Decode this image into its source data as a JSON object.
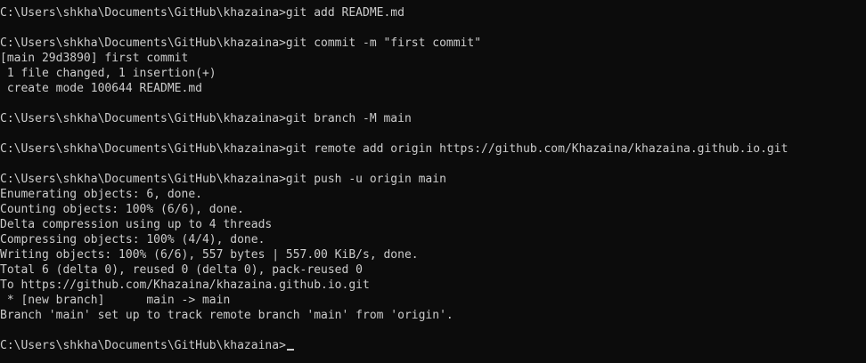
{
  "terminal": {
    "lines": [
      "C:\\Users\\shkha\\Documents\\GitHub\\khazaina>git add README.md",
      "",
      "C:\\Users\\shkha\\Documents\\GitHub\\khazaina>git commit -m \"first commit\"",
      "[main 29d3890] first commit",
      " 1 file changed, 1 insertion(+)",
      " create mode 100644 README.md",
      "",
      "C:\\Users\\shkha\\Documents\\GitHub\\khazaina>git branch -M main",
      "",
      "C:\\Users\\shkha\\Documents\\GitHub\\khazaina>git remote add origin https://github.com/Khazaina/khazaina.github.io.git",
      "",
      "C:\\Users\\shkha\\Documents\\GitHub\\khazaina>git push -u origin main",
      "Enumerating objects: 6, done.",
      "Counting objects: 100% (6/6), done.",
      "Delta compression using up to 4 threads",
      "Compressing objects: 100% (4/4), done.",
      "Writing objects: 100% (6/6), 557 bytes | 557.00 KiB/s, done.",
      "Total 6 (delta 0), reused 0 (delta 0), pack-reused 0",
      "To https://github.com/Khazaina/khazaina.github.io.git",
      " * [new branch]      main -> main",
      "Branch 'main' set up to track remote branch 'main' from 'origin'.",
      ""
    ],
    "prompt": "C:\\Users\\shkha\\Documents\\GitHub\\khazaina>"
  }
}
